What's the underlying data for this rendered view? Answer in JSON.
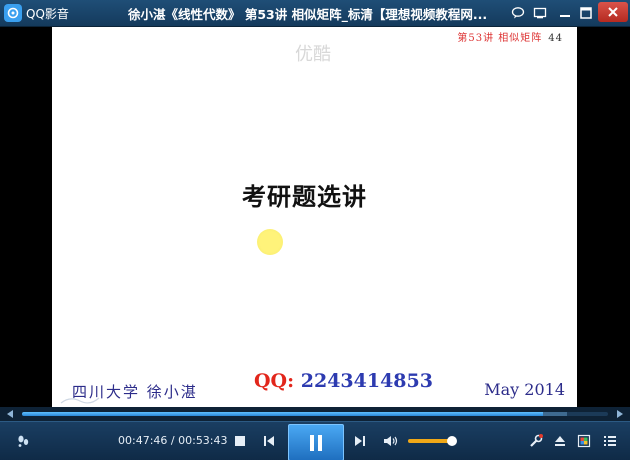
{
  "window": {
    "app_name": "QQ影音",
    "title": "徐小湛《线性代数》 第53讲 相似矩阵_标清【理想视频教程网..."
  },
  "slide": {
    "header_text": "第53讲  相似矩阵",
    "page_number": "44",
    "watermark": "优酷",
    "title": "考研题选讲",
    "footer_left": "四川大学   徐小湛",
    "qq_label": "QQ:",
    "qq_number": "2243414853",
    "footer_right": "May 2014"
  },
  "player": {
    "current_time": "00:47:46",
    "total_time": "00:53:43",
    "time_separator": " / ",
    "progress_fraction": 0.889,
    "buffer_fraction": 0.93,
    "volume_fraction": 0.95
  },
  "colors": {
    "accent": "#2a86d6",
    "volume": "#f0a818",
    "close": "#c63a2f",
    "qq_label": "#e2261b",
    "qq_number": "#2d3bb0"
  },
  "icons": {
    "titlebar": [
      "chat-icon",
      "screen-icon",
      "minimize-icon",
      "maximize-icon",
      "close-icon"
    ],
    "controls": [
      "footprint-icon",
      "stop-icon",
      "previous-icon",
      "pause-icon",
      "next-icon",
      "volume-icon",
      "tools-icon",
      "eject-icon",
      "color-icon",
      "playlist-icon"
    ]
  }
}
